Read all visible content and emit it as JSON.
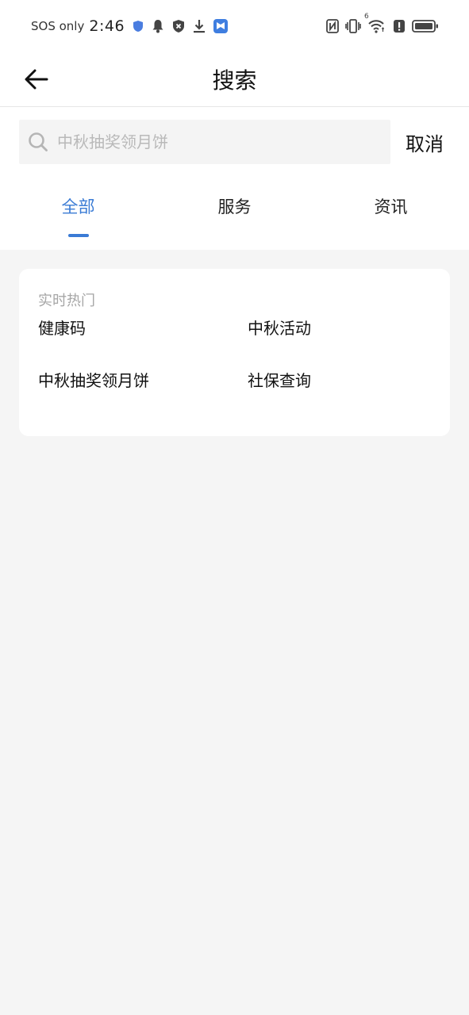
{
  "status_bar": {
    "carrier": "SOS only",
    "time": "2:46",
    "left_icons": [
      "shield-icon",
      "bell-icon",
      "security-x-icon",
      "download-icon",
      "app-notification-icon"
    ],
    "right_icons": [
      "nfc-icon",
      "vibrate-icon",
      "wifi-icon",
      "alert-icon",
      "battery-icon"
    ],
    "wifi_badge": "6"
  },
  "header": {
    "title": "搜索",
    "back_icon": "arrow-left-icon"
  },
  "search": {
    "placeholder": "中秋抽奖领月饼",
    "value": "",
    "cancel_label": "取消"
  },
  "tabs": [
    {
      "label": "全部",
      "active": true
    },
    {
      "label": "服务",
      "active": false
    },
    {
      "label": "资讯",
      "active": false
    }
  ],
  "hot": {
    "title": "实时热门",
    "items": [
      "健康码",
      "中秋活动",
      "中秋抽奖领月饼",
      "社保查询"
    ]
  },
  "colors": {
    "accent": "#3a7bd5",
    "background": "#f5f5f5",
    "card": "#ffffff",
    "placeholder": "#b9b9b9"
  }
}
